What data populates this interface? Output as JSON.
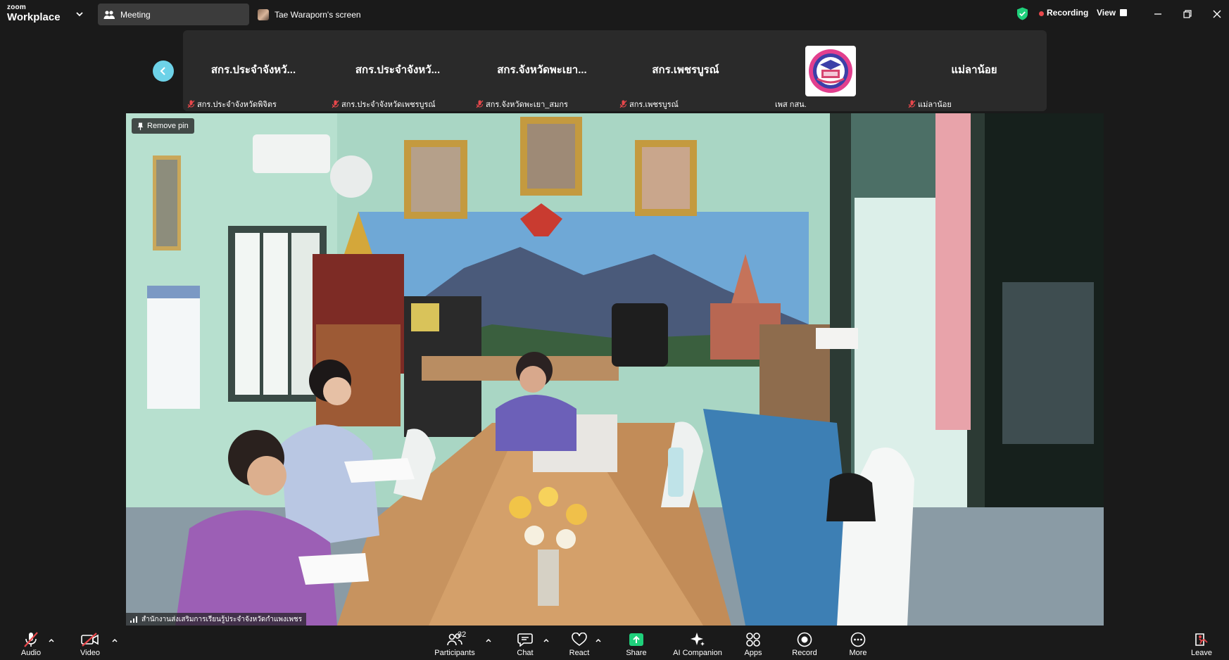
{
  "app": {
    "brand_small": "zoom",
    "brand_name": "Workplace"
  },
  "tabs": {
    "meeting": "Meeting",
    "screen": "Tae Waraporn's screen"
  },
  "status": {
    "recording": "Recording",
    "view": "View"
  },
  "participants_strip": [
    {
      "name": "สกร.ประจำจังหวั...",
      "caption": "สกร.ประจำจังหวัดพิจิตร",
      "muted": true
    },
    {
      "name": "สกร.ประจำจังหวั...",
      "caption": "สกร.ประจำจังหวัดเพชรบูรณ์",
      "muted": true
    },
    {
      "name": "สกร.จังหวัดพะเยา...",
      "caption": "สกร.จังหวัดพะเยา_สมกร",
      "muted": true
    },
    {
      "name": "สกร.เพชรบูรณ์",
      "caption": "สกร.เพชรบูรณ์",
      "muted": true
    },
    {
      "name": "",
      "caption": "เพส กสน.",
      "muted": false,
      "has_logo": true
    },
    {
      "name": "แม่ลาน้อย",
      "caption": "แม่ลาน้อย",
      "muted": true
    }
  ],
  "main_video": {
    "pin_label": "Remove pin",
    "name": "สำนักงานส่งเสริมการเรียนรู้ประจำจังหวัดกำแพงเพชร"
  },
  "toolbar": {
    "audio": "Audio",
    "video": "Video",
    "participants": "Participants",
    "participants_count": "32",
    "chat": "Chat",
    "react": "React",
    "share": "Share",
    "ai": "AI Companion",
    "apps": "Apps",
    "record": "Record",
    "more": "More",
    "leave": "Leave"
  },
  "colors": {
    "accent": "#6dd2e8",
    "share_green": "#1fd07b",
    "mute_red": "#e8474b",
    "leave": "#e8474b"
  },
  "icons": [
    "chevron-down-icon",
    "participants-icon",
    "shield-check-icon",
    "minimize-icon",
    "restore-icon",
    "close-icon",
    "chevron-left-icon",
    "mic-muted-icon",
    "pin-icon",
    "signal-icon",
    "mic-slash-icon",
    "video-slash-icon",
    "chat-icon",
    "heart-icon",
    "share-arrow-icon",
    "sparkle-icon",
    "apps-icon",
    "record-icon",
    "more-icon",
    "leave-icon"
  ]
}
